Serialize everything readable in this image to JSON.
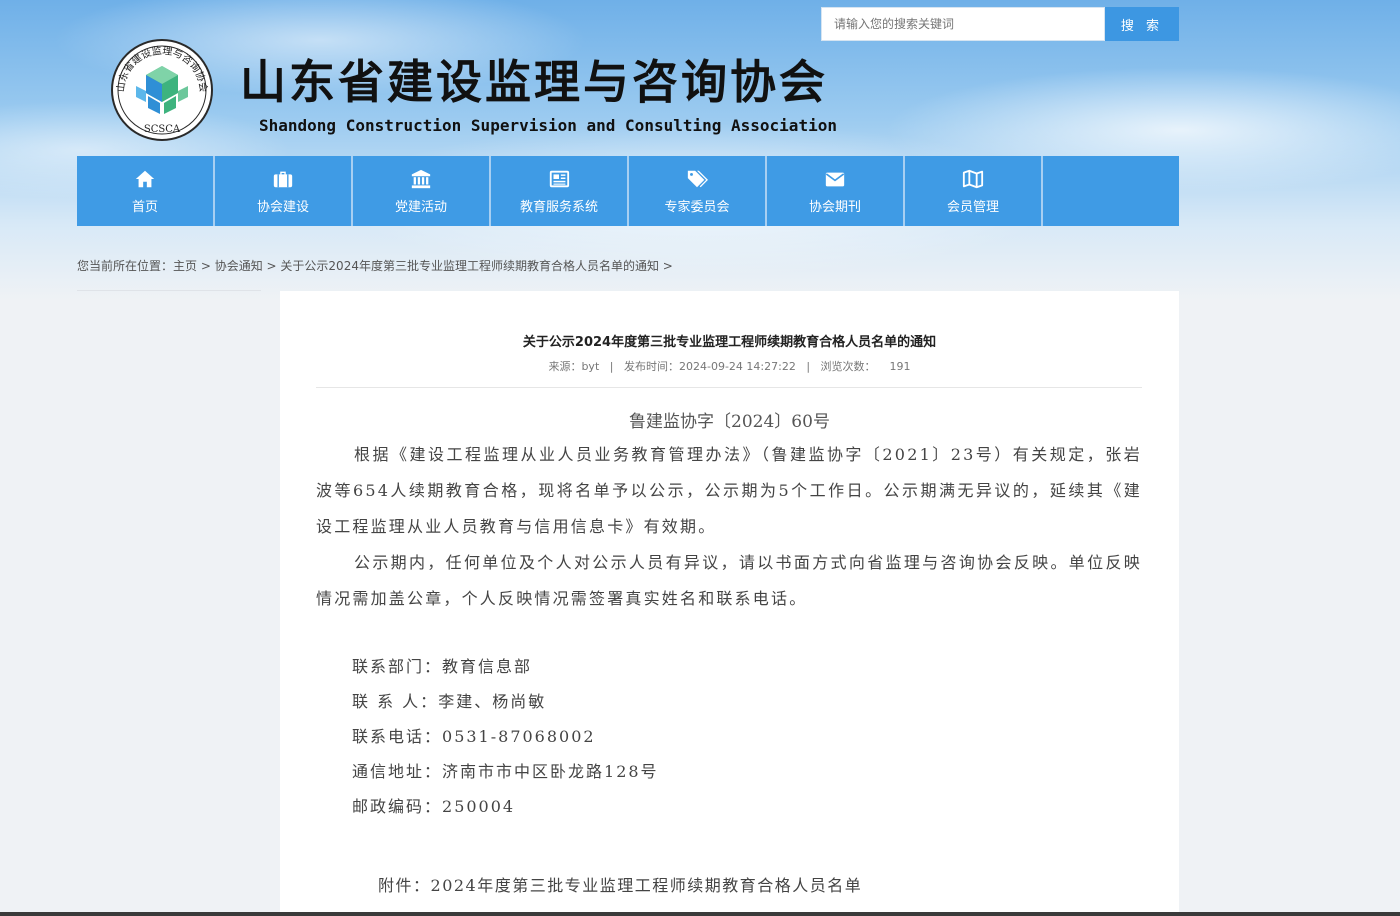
{
  "search": {
    "placeholder": "请输入您的搜索关键词",
    "button_label": "搜 索"
  },
  "header": {
    "title": "山东省建设监理与咨询协会",
    "subtitle": "Shandong Construction Supervision and Consulting Association",
    "logo_text": "山东省建设监理与咨询协会",
    "logo_abbr": "SCSCA"
  },
  "nav": {
    "items": [
      {
        "label": "首页",
        "icon": "home-icon"
      },
      {
        "label": "协会建设",
        "icon": "briefcase-icon"
      },
      {
        "label": "党建活动",
        "icon": "bank-icon"
      },
      {
        "label": "教育服务系统",
        "icon": "newspaper-icon"
      },
      {
        "label": "专家委员会",
        "icon": "tags-icon"
      },
      {
        "label": "协会期刊",
        "icon": "envelope-icon"
      },
      {
        "label": "会员管理",
        "icon": "map-icon"
      }
    ]
  },
  "breadcrumb": {
    "prefix": "您当前所在位置：",
    "home": "主页",
    "section": "协会通知",
    "current": "关于公示2024年度第三批专业监理工程师续期教育合格人员名单的通知",
    "sep": " > "
  },
  "article": {
    "title": "关于公示2024年度第三批专业监理工程师续期教育合格人员名单的通知",
    "source_label": "来源：",
    "source": "byt",
    "date_label": "发布时间：",
    "date": "2024-09-24 14:27:22",
    "views_label": "浏览次数：",
    "views": "191",
    "meta_sep": "|",
    "doc_number": "鲁建监协字〔2024〕60号",
    "paragraph1": "根据《建设工程监理从业人员业务教育管理办法》（鲁建监协字〔2021〕23号）有关规定，张岩波等654人续期教育合格，现将名单予以公示，公示期为5个工作日。公示期满无异议的，延续其《建设工程监理从业人员教育与信用信息卡》有效期。",
    "paragraph2": "公示期内，任何单位及个人对公示人员有异议，请以书面方式向省监理与咨询协会反映。单位反映情况需加盖公章，个人反映情况需签署真实姓名和联系电话。",
    "contact": [
      {
        "label": "联系部门：",
        "value": "教育信息部"
      },
      {
        "label": "联 系 人：",
        "value": "李建、杨尚敏"
      },
      {
        "label": "联系电话：",
        "value": "0531-87068002"
      },
      {
        "label": "通信地址：",
        "value": "济南市市中区卧龙路128号"
      },
      {
        "label": "邮政编码：",
        "value": "250004"
      }
    ],
    "attachment_label": "附件：",
    "attachment": "2024年度第三批专业监理工程师续期教育合格人员名单"
  },
  "colors": {
    "nav_bg": "#3f9be5",
    "search_button": "#3d97e2",
    "logo_green": "#3db37e",
    "logo_blue": "#2f8fd6"
  }
}
